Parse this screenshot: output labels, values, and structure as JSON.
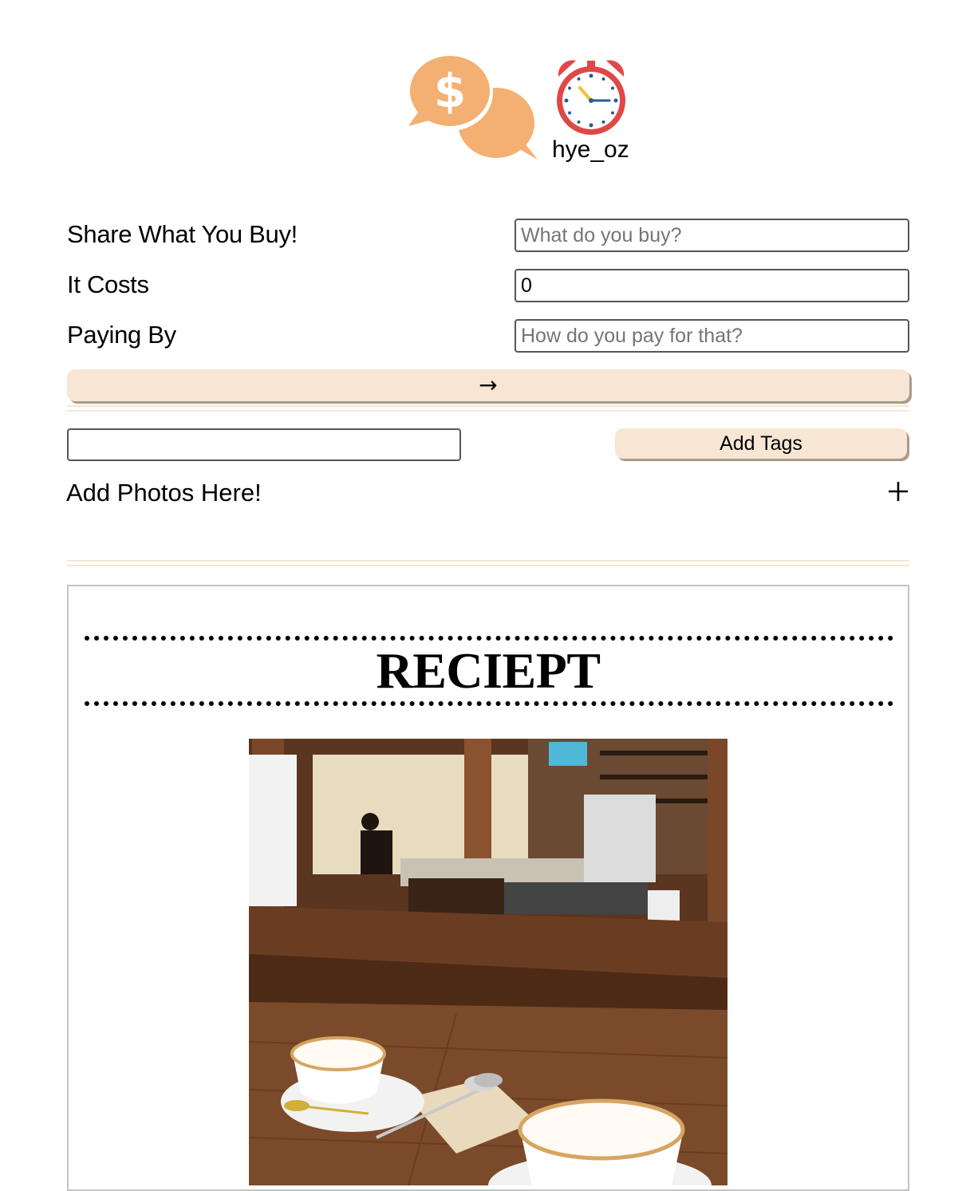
{
  "header": {
    "username": "hye_oz",
    "logo_icon": "money-chat-icon",
    "timer_icon": "alarm-clock-icon"
  },
  "form": {
    "item_label": "Share What You Buy!",
    "item_placeholder": "What do you buy?",
    "item_value": "",
    "cost_label": "It Costs",
    "cost_value": "0",
    "payment_label": "Paying By",
    "payment_placeholder": "How do you pay for that?",
    "payment_value": "",
    "submit_label": "→"
  },
  "tags": {
    "input_value": "",
    "button_label": "Add Tags"
  },
  "photos": {
    "label": "Add Photos Here!",
    "add_icon": "plus-icon"
  },
  "receipt": {
    "title": "RECIEPT",
    "photo_icon": "cafe-photo"
  },
  "colors": {
    "accent": "#f7e6d3",
    "button_shadow": "#a99a8a",
    "logo_orange": "#f3b072",
    "clock_red": "#e04848"
  }
}
